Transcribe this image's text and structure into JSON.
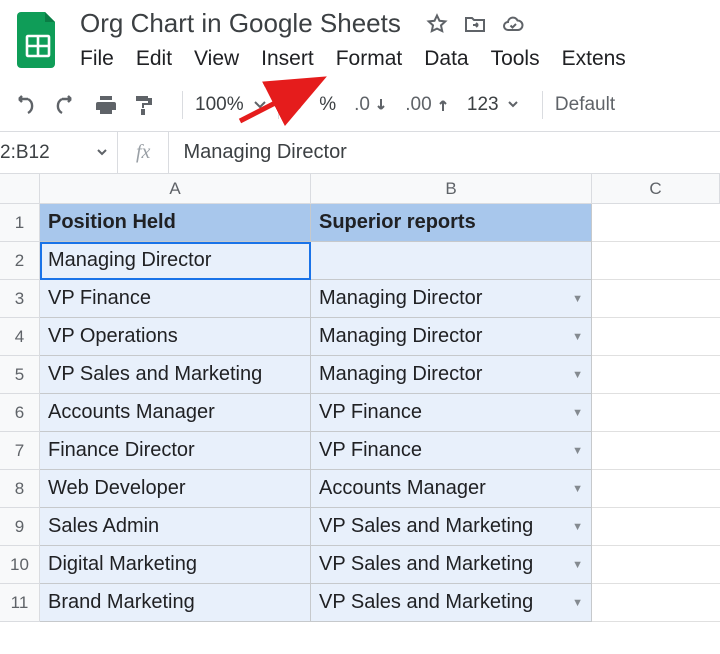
{
  "doc": {
    "title": "Org Chart in Google Sheets"
  },
  "menus": [
    "File",
    "Edit",
    "View",
    "Insert",
    "Format",
    "Data",
    "Tools",
    "Extens"
  ],
  "toolbar": {
    "zoom": "100%",
    "currency": "$",
    "percent": "%",
    "dec_down": ".0",
    "dec_up": ".00",
    "numfmt": "123",
    "font": "Default"
  },
  "namebox": "2:B12",
  "fx_label": "fx",
  "formula_value": "Managing Director",
  "columns": [
    "A",
    "B",
    "C"
  ],
  "header_row": {
    "a": "Position Held",
    "b": "Superior reports"
  },
  "rows": [
    {
      "n": "1"
    },
    {
      "n": "2",
      "a": "Managing Director",
      "b": ""
    },
    {
      "n": "3",
      "a": "VP Finance",
      "b": "Managing Director"
    },
    {
      "n": "4",
      "a": "VP Operations",
      "b": "Managing Director"
    },
    {
      "n": "5",
      "a": "VP Sales and Marketing",
      "b": "Managing Director"
    },
    {
      "n": "6",
      "a": "Accounts Manager",
      "b": "VP Finance"
    },
    {
      "n": "7",
      "a": "Finance Director",
      "b": "VP Finance"
    },
    {
      "n": "8",
      "a": "Web Developer",
      "b": "Accounts Manager"
    },
    {
      "n": "9",
      "a": "Sales Admin",
      "b": "VP Sales and Marketing"
    },
    {
      "n": "10",
      "a": "Digital Marketing",
      "b": "VP Sales and Marketing"
    },
    {
      "n": "11",
      "a": "Brand Marketing",
      "b": "VP Sales and Marketing"
    }
  ],
  "caret_glyph": "▼"
}
